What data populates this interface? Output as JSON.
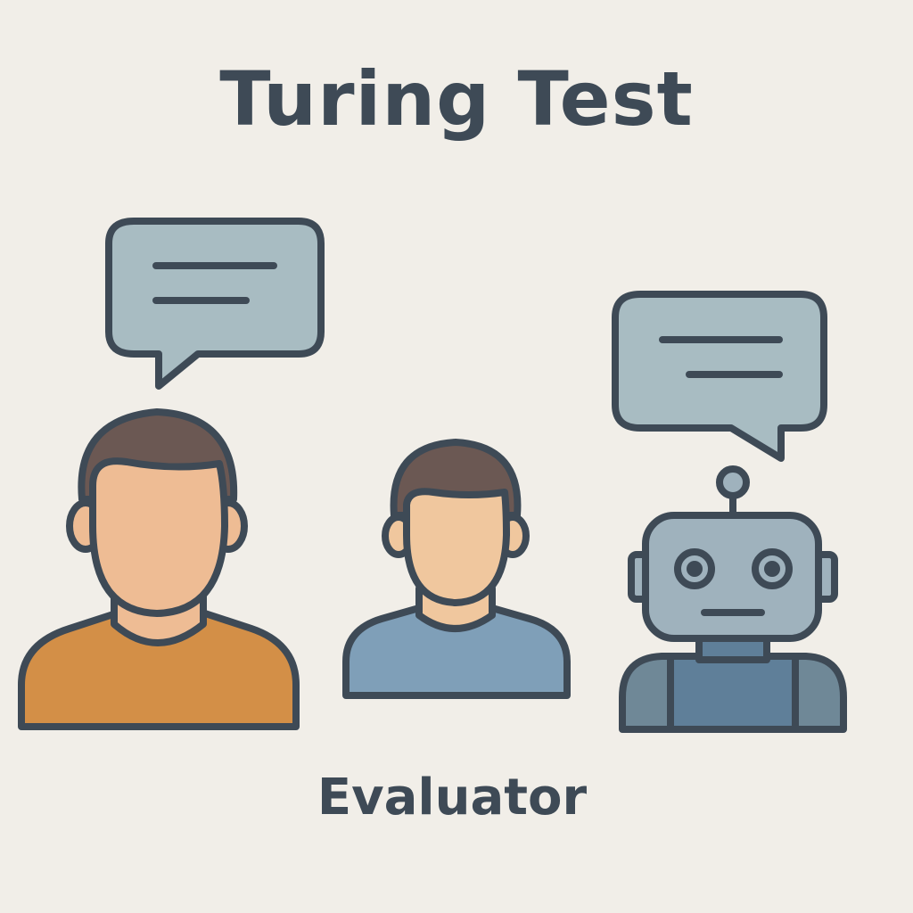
{
  "title": "Turing Test",
  "caption": "Evaluator",
  "colors": {
    "background": "#f1eee8",
    "outline": "#3e4a56",
    "bubble_fill": "#a8bcc2",
    "skin_left": "#eebc94",
    "skin_middle": "#f0c79e",
    "hair": "#6b5853",
    "shirt_left": "#d38f47",
    "shirt_middle": "#7f9fb8",
    "robot_head": "#9fb2bd",
    "robot_body": "#5f7f99",
    "robot_shoulders": "#6f8897"
  },
  "icons": [
    "speech-bubble-icon",
    "human-person-icon",
    "evaluator-person-icon",
    "robot-icon"
  ]
}
